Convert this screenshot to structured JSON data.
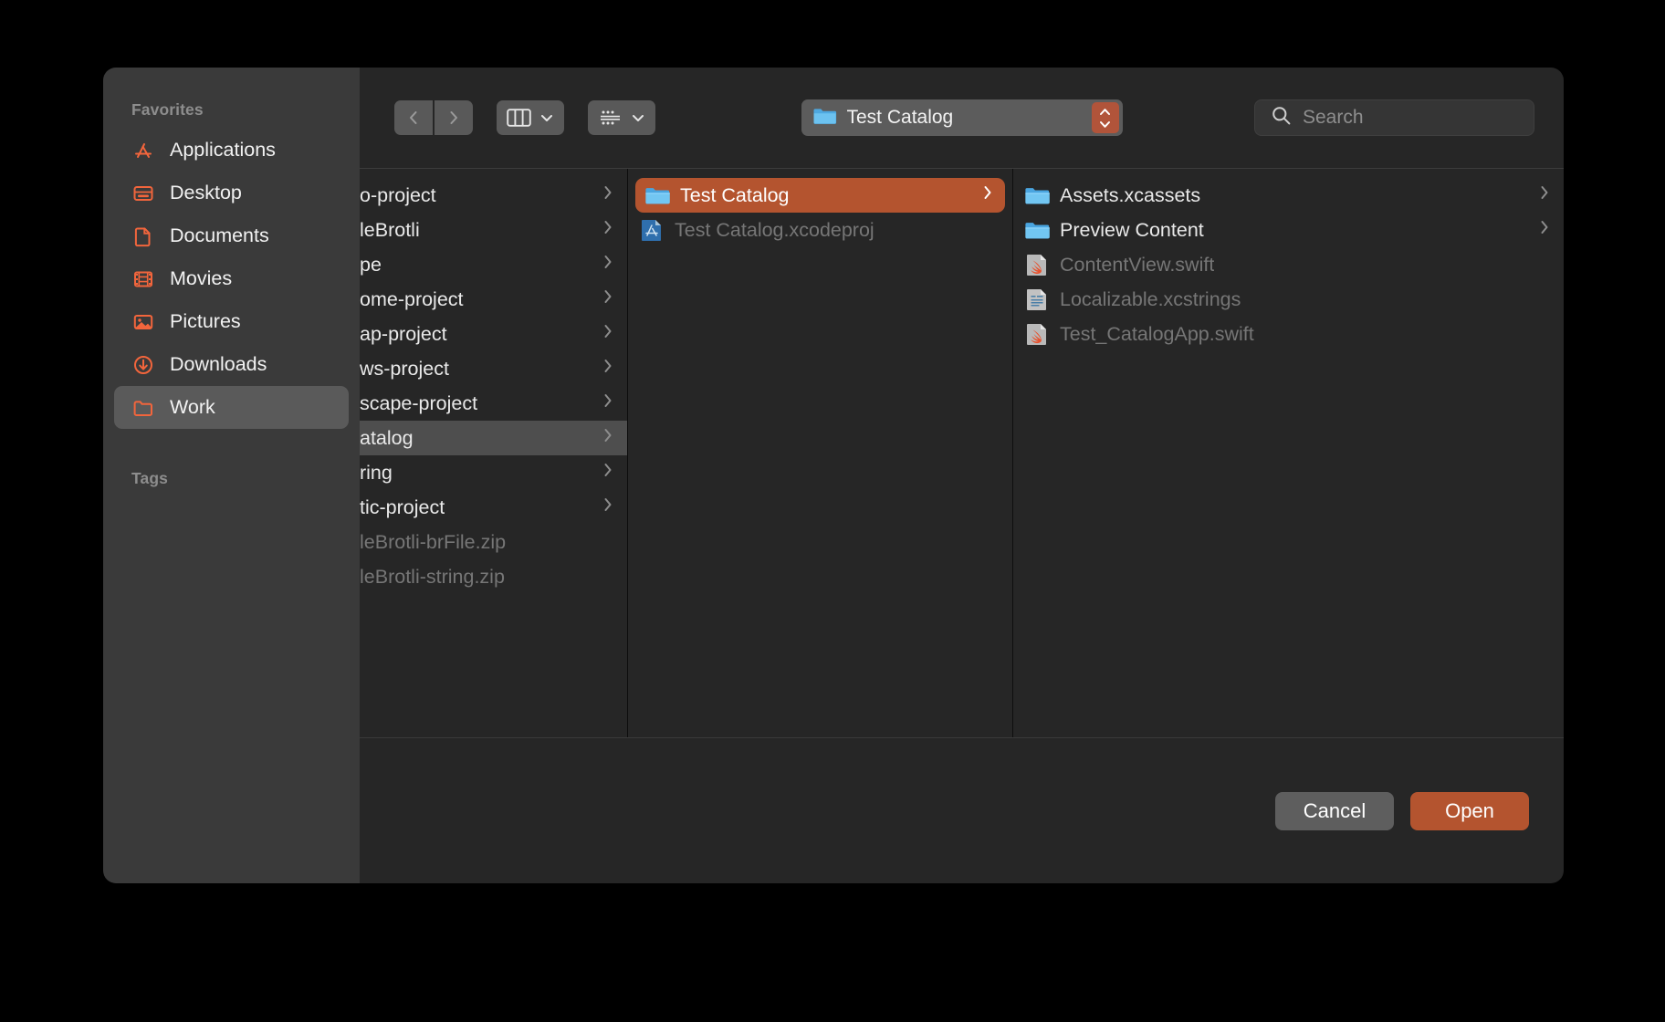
{
  "sidebar": {
    "sections": [
      {
        "header": "Favorites",
        "items": [
          {
            "label": "Applications",
            "icon": "applications-icon",
            "selected": false
          },
          {
            "label": "Desktop",
            "icon": "desktop-icon",
            "selected": false
          },
          {
            "label": "Documents",
            "icon": "documents-icon",
            "selected": false
          },
          {
            "label": "Movies",
            "icon": "movies-icon",
            "selected": false
          },
          {
            "label": "Pictures",
            "icon": "pictures-icon",
            "selected": false
          },
          {
            "label": "Downloads",
            "icon": "downloads-icon",
            "selected": false
          },
          {
            "label": "Work",
            "icon": "folder-icon",
            "selected": true
          }
        ]
      },
      {
        "header": "Tags",
        "items": []
      }
    ]
  },
  "toolbar": {
    "back_icon": "chevron-left-icon",
    "forward_icon": "chevron-right-icon",
    "view_column_icon": "column-view-icon",
    "view_gallery_icon": "gallery-view-icon",
    "path_label": "Test Catalog",
    "path_icon": "folder-icon",
    "stepper_icon": "updown-stepper-icon",
    "search_placeholder": "Search",
    "search_value": "",
    "search_icon": "search-icon"
  },
  "columns": [
    {
      "name": "column-1",
      "items": [
        {
          "label": "o-project",
          "type": "folder",
          "state": "normal",
          "chevron": true
        },
        {
          "label": "leBrotli",
          "type": "folder",
          "state": "normal",
          "chevron": true
        },
        {
          "label": "pe",
          "type": "folder",
          "state": "normal",
          "chevron": true
        },
        {
          "label": "ome-project",
          "type": "folder",
          "state": "normal",
          "chevron": true
        },
        {
          "label": "ap-project",
          "type": "folder",
          "state": "normal",
          "chevron": true
        },
        {
          "label": "ws-project",
          "type": "folder",
          "state": "normal",
          "chevron": true
        },
        {
          "label": "scape-project",
          "type": "folder",
          "state": "normal",
          "chevron": true
        },
        {
          "label": "atalog",
          "type": "folder",
          "state": "highlight",
          "chevron": true
        },
        {
          "label": "ring",
          "type": "folder",
          "state": "normal",
          "chevron": true
        },
        {
          "label": "tic-project",
          "type": "folder",
          "state": "normal",
          "chevron": true
        },
        {
          "label": "leBrotli-brFile.zip",
          "type": "zip",
          "state": "dim",
          "chevron": false
        },
        {
          "label": "leBrotli-string.zip",
          "type": "zip",
          "state": "dim",
          "chevron": false
        }
      ]
    },
    {
      "name": "column-2",
      "items": [
        {
          "label": "Test Catalog",
          "type": "folder",
          "state": "selected",
          "chevron": true
        },
        {
          "label": "Test Catalog.xcodeproj",
          "type": "xcodeproj",
          "state": "dim",
          "chevron": false
        }
      ]
    },
    {
      "name": "column-3",
      "items": [
        {
          "label": "Assets.xcassets",
          "type": "folder",
          "state": "normal",
          "chevron": true
        },
        {
          "label": "Preview Content",
          "type": "folder",
          "state": "normal",
          "chevron": true
        },
        {
          "label": "ContentView.swift",
          "type": "swift",
          "state": "dim",
          "chevron": false
        },
        {
          "label": "Localizable.xcstrings",
          "type": "xcstrings",
          "state": "dim",
          "chevron": false
        },
        {
          "label": "Test_CatalogApp.swift",
          "type": "swift",
          "state": "dim",
          "chevron": false
        }
      ]
    }
  ],
  "footer": {
    "cancel_label": "Cancel",
    "open_label": "Open"
  },
  "colors": {
    "accent": "#b4542f",
    "sidebar_icon": "#f2653c",
    "window_bg": "#262626",
    "sidebar_bg": "#3a3a3a",
    "folder_blue": "#5bb8ef"
  }
}
